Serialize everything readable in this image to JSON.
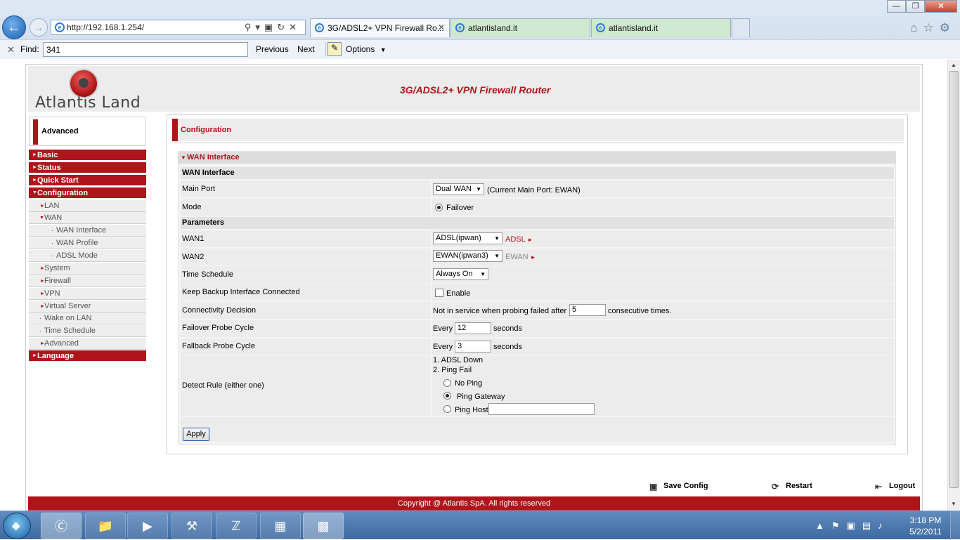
{
  "browser": {
    "url": "http://192.168.1.254/",
    "tabs": [
      {
        "label": "3G/ADSL2+ VPN Firewall Ro..."
      },
      {
        "label": "atlantisland.it"
      },
      {
        "label": "atlantisland.it"
      }
    ],
    "find": {
      "label": "Find:",
      "value": "341",
      "previous": "Previous",
      "next": "Next",
      "options": "Options"
    }
  },
  "header": {
    "logo_text": "Atlantis Land",
    "product": "3G/ADSL2+ VPN Firewall Router"
  },
  "nav": {
    "mode_label": "Advanced",
    "main": [
      {
        "label": "Basic"
      },
      {
        "label": "Status"
      },
      {
        "label": "Quick Start"
      },
      {
        "label": "Configuration"
      }
    ],
    "config_sub": [
      {
        "label": "LAN"
      },
      {
        "label": "WAN"
      },
      {
        "label": "WAN Interface"
      },
      {
        "label": "WAN Profile"
      },
      {
        "label": "ADSL Mode"
      },
      {
        "label": "System"
      },
      {
        "label": "Firewall"
      },
      {
        "label": "VPN"
      },
      {
        "label": "Virtual Server"
      },
      {
        "label": "Wake on LAN"
      },
      {
        "label": "Time Schedule"
      },
      {
        "label": "Advanced"
      }
    ],
    "language": "Language"
  },
  "content": {
    "page_title": "Configuration",
    "section_title": "WAN Interface",
    "sub1": "WAN Interface",
    "main_port": {
      "label": "Main Port",
      "value": "Dual WAN",
      "note": "(Current Main Port: EWAN)"
    },
    "mode": {
      "label": "Mode",
      "option": "Failover"
    },
    "sub2": "Parameters",
    "wan1": {
      "label": "WAN1",
      "value": "ADSL(ipwan)",
      "link": "ADSL"
    },
    "wan2": {
      "label": "WAN2",
      "value": "EWAN(ipwan3)",
      "link": "EWAN"
    },
    "time_schedule": {
      "label": "Time Schedule",
      "value": "Always On"
    },
    "keep_backup": {
      "label": "Keep Backup Interface Connected",
      "option": "Enable"
    },
    "connectivity": {
      "label": "Connectivity Decision",
      "prefix": "Not in service when probing failed after",
      "value": "5",
      "suffix": "consecutive times."
    },
    "failover_probe": {
      "label": "Failover Probe Cycle",
      "prefix": "Every",
      "value": "12",
      "suffix": "seconds"
    },
    "fallback_probe": {
      "label": "Fallback Probe Cycle",
      "prefix": "Every",
      "value": "3",
      "suffix": "seconds"
    },
    "detect_rule": {
      "label": "Detect Rule (either one)",
      "line1": "1. ADSL Down",
      "line2": "2. Ping Fail",
      "options": [
        "No Ping",
        "Ping Gateway",
        "Ping Host"
      ],
      "selected": "Ping Gateway",
      "host_value": ""
    },
    "apply": "Apply"
  },
  "footer": {
    "save": "Save Config",
    "restart": "Restart",
    "logout": "Logout",
    "copyright": "Copyright @ Atlantis SpA. All rights reserved"
  },
  "taskbar": {
    "time": "3:18 PM",
    "date": "5/2/2011"
  },
  "colors": {
    "accent": "#b0141b",
    "panel": "#ececec"
  }
}
